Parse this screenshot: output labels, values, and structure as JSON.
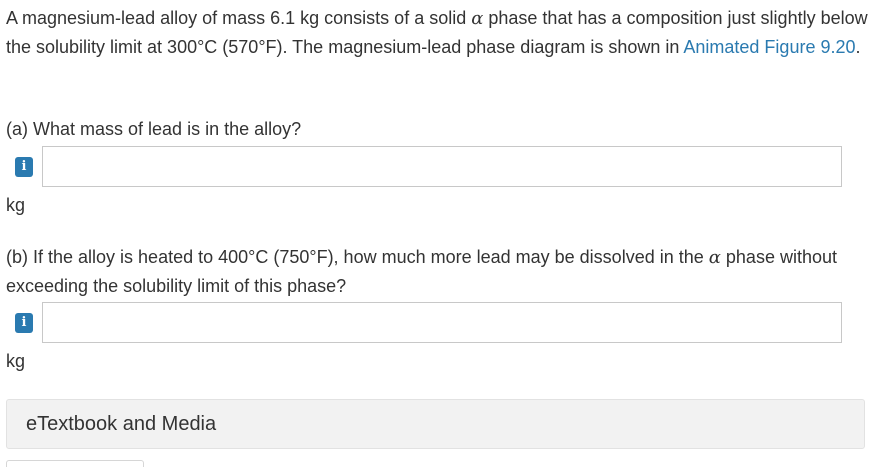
{
  "problem": {
    "intro_before_alpha": "A magnesium-lead alloy of mass 6.1 kg consists of a solid ",
    "alpha": "α",
    "intro_after_alpha": " phase that has a composition just slightly below the solubility limit at 300°C (570°F). The magnesium-lead phase diagram is shown in ",
    "figure_link": "Animated Figure 9.20",
    "intro_end": "."
  },
  "part_a": {
    "question": "(a) What mass of lead is in the alloy?",
    "info_icon": "i",
    "input_value": "",
    "unit": "kg"
  },
  "part_b": {
    "question_before_alpha": "(b) If the alloy is heated to 400°C (750°F), how much more lead may be dissolved in the ",
    "alpha": "α",
    "question_after_alpha": " phase without exceeding the solubility limit of this phase?",
    "info_icon": "i",
    "input_value": "",
    "unit": "kg"
  },
  "etextbook": {
    "label": "eTextbook and Media"
  },
  "colors": {
    "link": "#2a7ab0",
    "info_badge": "#2a7ab0",
    "panel_bg": "#f2f2f2"
  }
}
